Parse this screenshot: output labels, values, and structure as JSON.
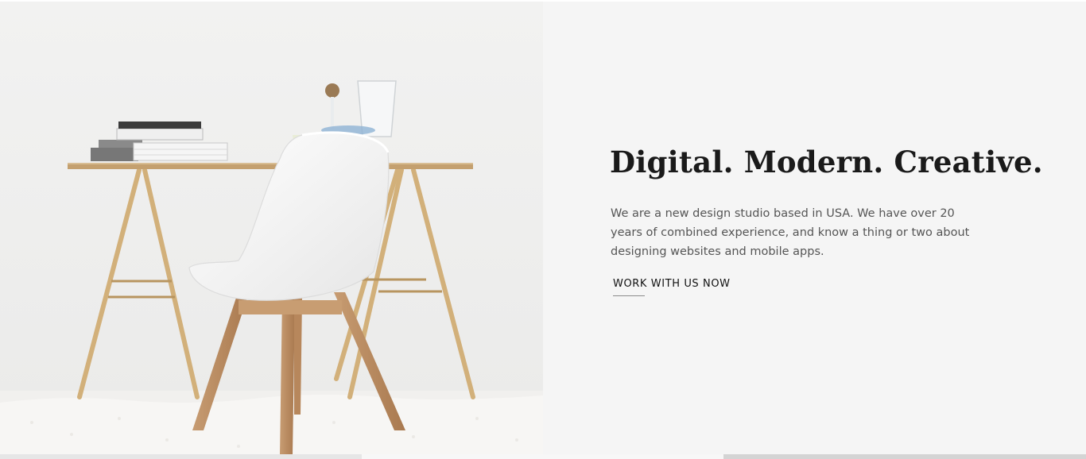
{
  "hero": {
    "headline": "Digital. Modern. Creative.",
    "intro": "We are a new design studio based in USA. We have over 20 years of combined experience, and know a thing or two about designing websites and mobile apps.",
    "cta_label": "WORK WITH US NOW"
  },
  "colors": {
    "text_panel_bg": "#f5f5f5",
    "headline": "#1a1a1a",
    "body_text": "#555555",
    "cta_text": "#111111"
  }
}
